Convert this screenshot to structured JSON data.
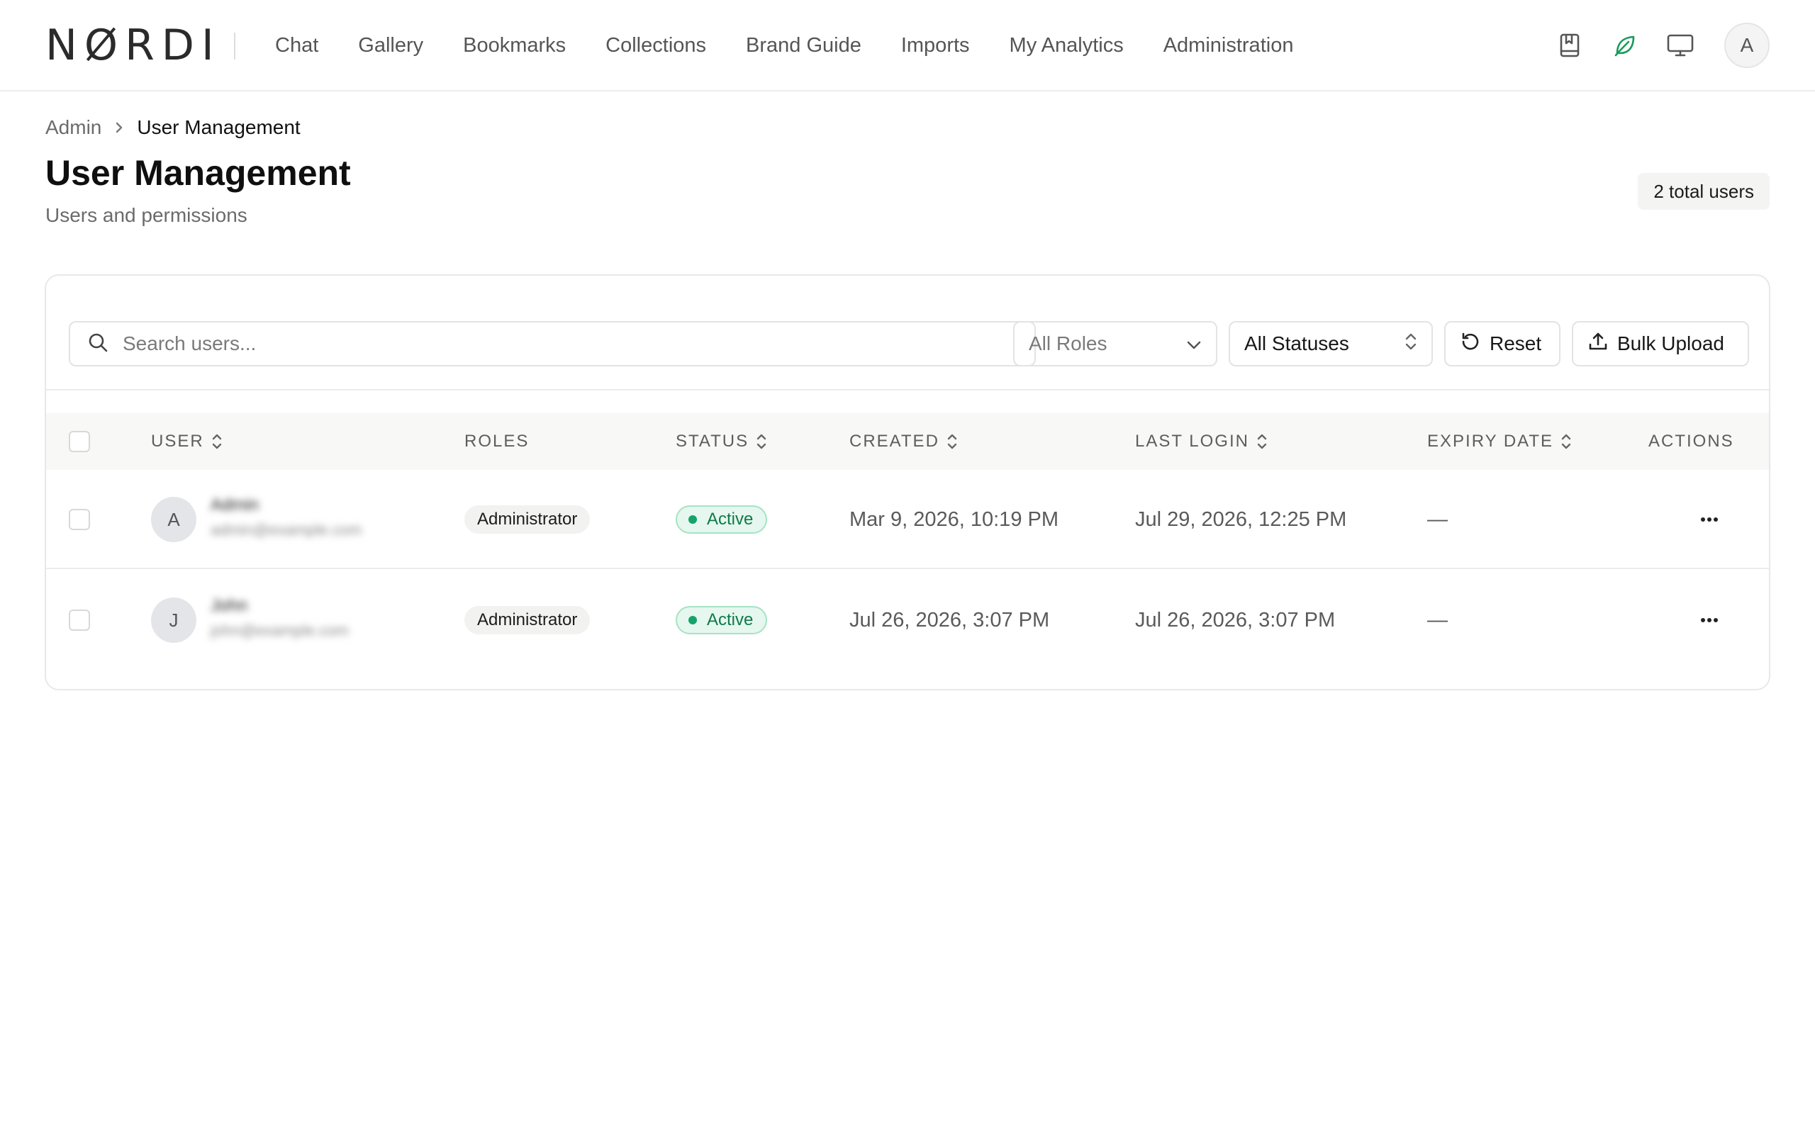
{
  "brand": {
    "logo_text": "NØRDI"
  },
  "nav": {
    "items": [
      {
        "label": "Chat"
      },
      {
        "label": "Gallery"
      },
      {
        "label": "Bookmarks"
      },
      {
        "label": "Collections"
      },
      {
        "label": "Brand Guide"
      },
      {
        "label": "Imports"
      },
      {
        "label": "My Analytics"
      },
      {
        "label": "Administration"
      }
    ]
  },
  "header": {
    "icons": [
      "bookmark-book-icon",
      "leaf-icon",
      "monitor-icon"
    ],
    "avatar_initial": "A"
  },
  "breadcrumb": {
    "root": "Admin",
    "current": "User Management"
  },
  "page": {
    "title": "User Management",
    "subtitle": "Users and permissions",
    "count_badge": "2 total users"
  },
  "toolbar": {
    "search_placeholder": "Search users...",
    "roles_filter": "All Roles",
    "status_filter": "All Statuses",
    "reset_label": "Reset",
    "bulk_upload_label": "Bulk Upload"
  },
  "table": {
    "columns": {
      "user": "USER",
      "roles": "ROLES",
      "status": "STATUS",
      "created": "CREATED",
      "last_login": "LAST LOGIN",
      "expiry_date": "EXPIRY DATE",
      "actions": "ACTIONS"
    },
    "rows": [
      {
        "avatar_initial": "A",
        "role": "Administrator",
        "status": "Active",
        "created": "Mar 9, 2026, 10:19 PM",
        "last_login": "Jul 29, 2026, 12:25 PM",
        "expiry_date": "—"
      },
      {
        "avatar_initial": "J",
        "role": "Administrator",
        "status": "Active",
        "created": "Jul 26, 2026, 3:07 PM",
        "last_login": "Jul 26, 2026, 3:07 PM",
        "expiry_date": "—"
      }
    ]
  },
  "colors": {
    "active_text": "#0f7a4a",
    "active_bg": "#e5f7ee",
    "active_dot": "#16a36a",
    "leaf_icon": "#1a9a5e"
  }
}
